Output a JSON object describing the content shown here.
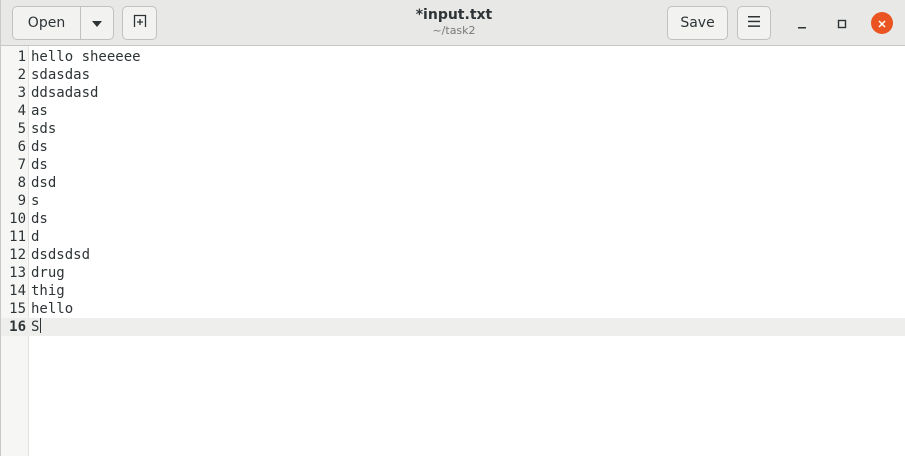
{
  "header": {
    "open_label": "Open",
    "title": "*input.txt",
    "subtitle": "~/task2",
    "save_label": "Save"
  },
  "icons": {
    "open_menu": "chevron-down-icon",
    "new_tab": "new-tab-icon",
    "hamburger": "hamburger-menu-icon",
    "minimize": "minimize-icon",
    "maximize": "maximize-icon",
    "close": "close-icon"
  },
  "colors": {
    "close_button": "#e95420",
    "current_line": "#eeeeec"
  },
  "editor": {
    "current_line": 16,
    "lines": [
      {
        "num": "1",
        "text": "hello sheeeee"
      },
      {
        "num": "2",
        "text": "sdasdas"
      },
      {
        "num": "3",
        "text": "ddsadasd"
      },
      {
        "num": "4",
        "text": "as"
      },
      {
        "num": "5",
        "text": "sds"
      },
      {
        "num": "6",
        "text": "ds"
      },
      {
        "num": "7",
        "text": "ds"
      },
      {
        "num": "8",
        "text": "dsd"
      },
      {
        "num": "9",
        "text": "s"
      },
      {
        "num": "10",
        "text": "ds"
      },
      {
        "num": "11",
        "text": "d"
      },
      {
        "num": "12",
        "text": "dsdsdsd"
      },
      {
        "num": "13",
        "text": "drug"
      },
      {
        "num": "14",
        "text": "thig"
      },
      {
        "num": "15",
        "text": "hello"
      },
      {
        "num": "16",
        "text": "S"
      }
    ]
  }
}
